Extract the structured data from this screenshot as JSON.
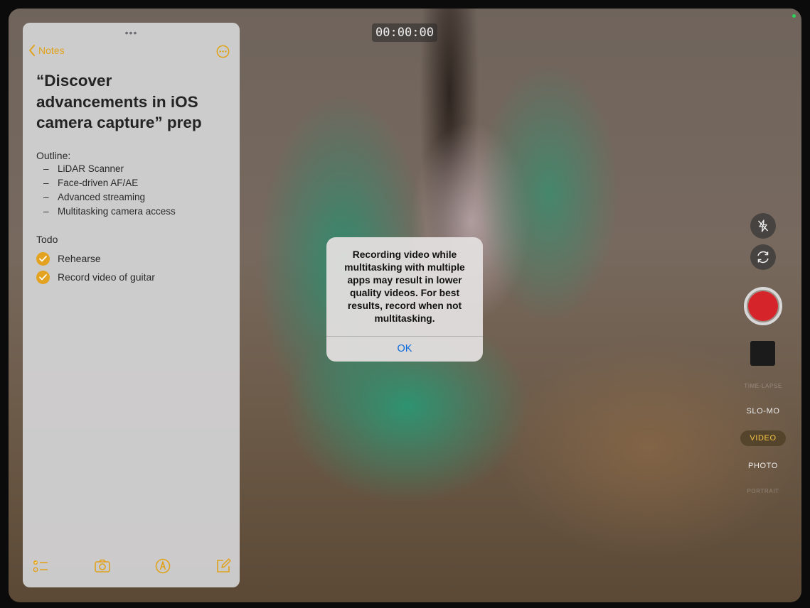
{
  "camera": {
    "timer": "00:00:00",
    "modes": {
      "time_lapse_faded": "TIME-LAPSE",
      "slo_mo": "SLO-MO",
      "video": "VIDEO",
      "photo": "PHOTO",
      "portrait_faded": "PORTRAIT"
    },
    "selected_mode": "VIDEO",
    "icons": {
      "flash": "flash-off-icon",
      "flip": "camera-flip-icon"
    },
    "colors": {
      "record": "#d6252a",
      "active_mode": "#f6c443"
    }
  },
  "alert": {
    "message": "Recording video while multitasking with multiple apps may result in lower quality videos. For best results, record when not multitasking.",
    "ok_label": "OK"
  },
  "notes": {
    "back_label": "Notes",
    "grabber": "•••",
    "title": "“Discover advancements in iOS camera capture” prep",
    "outline_heading": "Outline:",
    "outline_items": [
      "LiDAR Scanner",
      "Face-driven AF/AE",
      "Advanced streaming",
      "Multitasking camera access"
    ],
    "todo_heading": "Todo",
    "todo_items": [
      {
        "label": "Rehearse",
        "checked": true
      },
      {
        "label": "Record video of guitar",
        "checked": true
      }
    ],
    "accent": "#e0a21a",
    "toolbar_icons": [
      "checklist-icon",
      "camera-icon",
      "markup-icon",
      "compose-icon"
    ]
  }
}
